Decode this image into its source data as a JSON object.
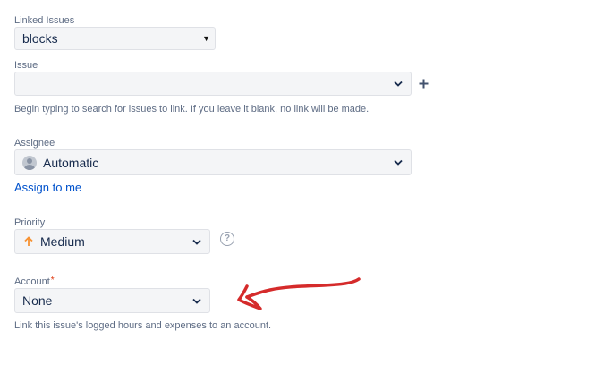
{
  "linked_issues": {
    "label": "Linked Issues",
    "value": "blocks"
  },
  "issue": {
    "label": "Issue",
    "value": "",
    "help": "Begin typing to search for issues to link. If you leave it blank, no link will be made.",
    "add_icon": "plus-icon"
  },
  "assignee": {
    "label": "Assignee",
    "value": "Automatic",
    "avatar_icon": "user-avatar-icon",
    "assign_to_me": "Assign to me"
  },
  "priority": {
    "label": "Priority",
    "value": "Medium",
    "priority_icon": "arrow-up-icon",
    "priority_color": "#f79232",
    "help_icon": "question-circle-icon"
  },
  "account": {
    "label": "Account",
    "required_marker": "*",
    "value": "None",
    "help": "Link this issue's logged hours and expenses to an account."
  },
  "annotation": {
    "type": "hand-drawn-arrow",
    "color": "#d52b2b"
  },
  "colors": {
    "link": "#0052cc",
    "label": "#5e6c84",
    "field_bg": "#f4f5f7",
    "field_border": "#dfe1e6",
    "required": "#de350b"
  }
}
